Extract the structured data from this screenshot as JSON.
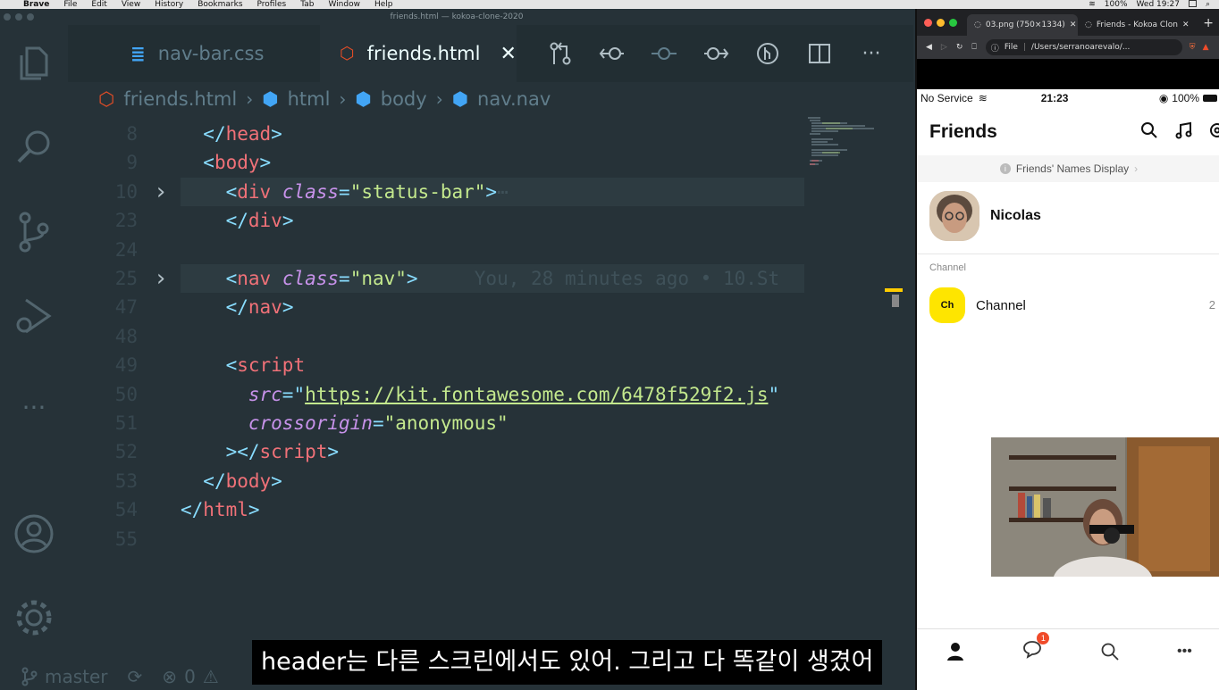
{
  "menubar": {
    "app": "Brave",
    "items": [
      "File",
      "Edit",
      "View",
      "History",
      "Bookmarks",
      "Profiles",
      "Tab",
      "Window",
      "Help"
    ],
    "battery": "100%",
    "clock": "Wed 19:27",
    "input_letter": "A"
  },
  "vscode": {
    "window_title": "friends.html — kokoa-clone-2020",
    "tabs": [
      {
        "label": "nav-bar.css",
        "icon": "css3-icon"
      },
      {
        "label": "friends.html",
        "icon": "html5-icon"
      }
    ],
    "breadcrumb": [
      "friends.html",
      "html",
      "body",
      "nav.nav"
    ],
    "lines": [
      {
        "num": "8",
        "fold": "",
        "indent": "  ",
        "parts": [
          [
            "pun",
            "</"
          ],
          [
            "tag",
            "head"
          ],
          [
            "pun",
            ">"
          ]
        ]
      },
      {
        "num": "9",
        "fold": "",
        "indent": "  ",
        "parts": [
          [
            "pun",
            "<"
          ],
          [
            "tag",
            "body"
          ],
          [
            "pun",
            ">"
          ]
        ]
      },
      {
        "num": "10",
        "fold": ">",
        "indent": "    ",
        "parts": [
          [
            "pun",
            "<"
          ],
          [
            "tag",
            "div"
          ],
          [
            "plain",
            " "
          ],
          [
            "attr",
            "class"
          ],
          [
            "pun",
            "="
          ],
          [
            "str",
            "\"status-bar\""
          ],
          [
            "pun",
            ">"
          ],
          [
            "blame",
            "⋯"
          ]
        ]
      },
      {
        "num": "23",
        "fold": "",
        "indent": "    ",
        "parts": [
          [
            "pun",
            "</"
          ],
          [
            "tag",
            "div"
          ],
          [
            "pun",
            ">"
          ]
        ]
      },
      {
        "num": "24",
        "fold": "",
        "indent": "",
        "parts": []
      },
      {
        "num": "25",
        "fold": ">",
        "indent": "    ",
        "parts": [
          [
            "pun",
            "<"
          ],
          [
            "tag",
            "nav"
          ],
          [
            "plain",
            " "
          ],
          [
            "attr",
            "class"
          ],
          [
            "pun",
            "="
          ],
          [
            "str",
            "\"nav\""
          ],
          [
            "pun",
            ">"
          ],
          [
            "blame",
            "     You, 28 minutes ago • 10.St"
          ]
        ]
      },
      {
        "num": "47",
        "fold": "",
        "indent": "    ",
        "parts": [
          [
            "pun",
            "</"
          ],
          [
            "tag",
            "nav"
          ],
          [
            "pun",
            ">"
          ]
        ]
      },
      {
        "num": "48",
        "fold": "",
        "indent": "",
        "parts": []
      },
      {
        "num": "49",
        "fold": "",
        "indent": "    ",
        "parts": [
          [
            "pun",
            "<"
          ],
          [
            "tag",
            "script"
          ]
        ]
      },
      {
        "num": "50",
        "fold": "",
        "indent": "      ",
        "parts": [
          [
            "attr",
            "src"
          ],
          [
            "pun",
            "="
          ],
          [
            "pun",
            "\""
          ],
          [
            "url",
            "https://kit.fontawesome.com/6478f529f2.js"
          ],
          [
            "pun",
            "\""
          ]
        ]
      },
      {
        "num": "51",
        "fold": "",
        "indent": "      ",
        "parts": [
          [
            "attr",
            "crossorigin"
          ],
          [
            "pun",
            "="
          ],
          [
            "str",
            "\"anonymous\""
          ]
        ]
      },
      {
        "num": "52",
        "fold": "",
        "indent": "    ",
        "parts": [
          [
            "pun",
            "></"
          ],
          [
            "tag",
            "script"
          ],
          [
            "pun",
            ">"
          ]
        ]
      },
      {
        "num": "53",
        "fold": "",
        "indent": "  ",
        "parts": [
          [
            "pun",
            "</"
          ],
          [
            "tag",
            "body"
          ],
          [
            "pun",
            ">"
          ]
        ]
      },
      {
        "num": "54",
        "fold": "",
        "indent": "",
        "parts": [
          [
            "pun",
            "</"
          ],
          [
            "tag",
            "html"
          ],
          [
            "pun",
            ">"
          ]
        ]
      },
      {
        "num": "55",
        "fold": "",
        "indent": "",
        "parts": []
      }
    ],
    "status": {
      "branch": "master",
      "errors": "0"
    }
  },
  "browser": {
    "tabs": [
      "03.png (750×1334)",
      "Friends - Kokoa Clon"
    ],
    "url_scheme": "File",
    "url": "/Users/serranoarevalo/..."
  },
  "phone": {
    "carrier": "No Service",
    "time": "21:23",
    "battery": "100%",
    "title": "Friends",
    "notice": "Friends' Names Display",
    "profile_name": "Nicolas",
    "section": "Channel",
    "channel_logo": "Ch",
    "channel_label": "Channel",
    "channel_count": "2",
    "chat_badge": "1"
  },
  "subtitle": "header는 다른 스크린에서도 있어. 그리고 다 똑같이 생겼어",
  "colors": {
    "tag": "#f07178",
    "attr": "#c792ea",
    "string": "#c3e88d",
    "punct": "#89ddff",
    "kakao_yellow": "#fee500",
    "badge": "#f04b2a"
  }
}
